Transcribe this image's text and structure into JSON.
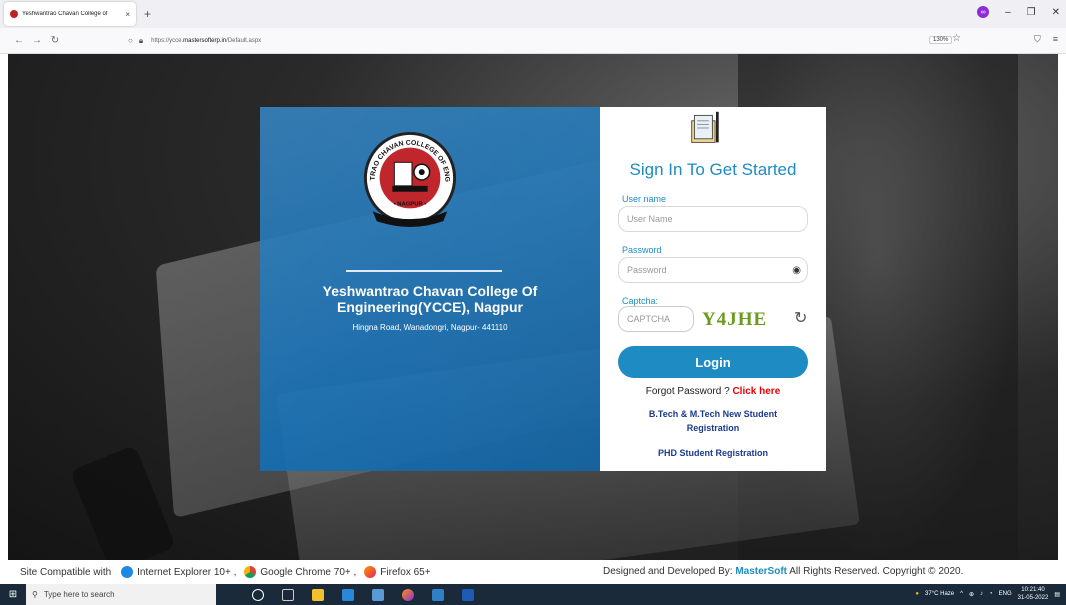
{
  "browser": {
    "tab_title": "Yeshwantrao Chavan College of",
    "tab_close": "×",
    "new_tab": "+",
    "url_prefix": "https://ycce.",
    "url_domain": "mastersofterp.in",
    "url_path": "/Default.aspx",
    "zoom": "130%"
  },
  "college": {
    "name": "Yeshwantrao Chavan College Of Engineering(YCCE), Nagpur",
    "address": "Hingna Road, Wanadongri, Nagpur- 441110",
    "logo_text": {
      "arc": "YESHWANTRAO CHAVAN COLLEGE OF ENGINEERING",
      "place": "• NAGPUR •"
    }
  },
  "login": {
    "heading": "Sign In To Get Started",
    "username_label": "User name",
    "username_placeholder": "User Name",
    "password_label": "Password",
    "password_placeholder": "Password",
    "captcha_label": "Captcha:",
    "captcha_placeholder": "CAPTCHA",
    "captcha_text": "Y4JHE",
    "login_button": "Login",
    "forgot_prefix": "Forgot Password ? ",
    "forgot_link": "Click here",
    "btech_line1": "B.Tech & M.Tech New Student",
    "btech_line2": "Registration",
    "phd_link": "PHD Student Registration"
  },
  "footer": {
    "compat_label": "Site Compatible with",
    "ie": "Internet Explorer 10+ ,",
    "chrome": "Google Chrome 70+ ,",
    "firefox": "Firefox 65+",
    "credit_prefix": "Designed and Developed By:",
    "credit_brand": "MasterSoft",
    "credit_suffix": "All Rights Reserved. Copyright © 2020."
  },
  "taskbar": {
    "search_placeholder": "Type here to search",
    "weather": "37°C Haze",
    "lang": "ENG",
    "time": "10:21:40",
    "date": "31-05-2022"
  },
  "colors": {
    "accent": "#1e8bc3",
    "link_red": "#e00000",
    "link_navy": "#1b3a8c"
  }
}
